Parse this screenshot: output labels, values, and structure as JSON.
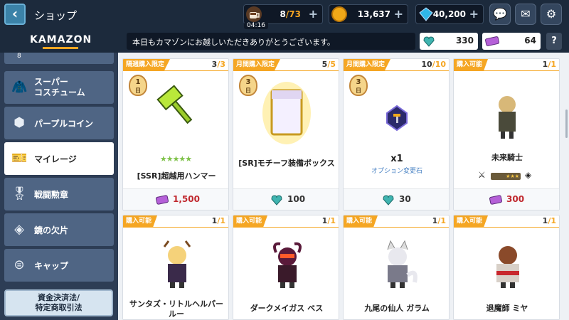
{
  "header": {
    "title": "ショップ",
    "stamina": {
      "value": "8",
      "max": "/73",
      "timer": "04:16"
    },
    "gold": "13,637",
    "gems": "40,200"
  },
  "subheader": {
    "logo": "KAMAZON",
    "notice": "本日もカマゾンにお越しいただきありがとうございます。",
    "currency_hearts": "330",
    "currency_tickets": "64",
    "help": "?"
  },
  "sidebar": {
    "partial_top": "8",
    "items": [
      {
        "label": "スーパー\nコスチューム",
        "icon": "jacket-icon"
      },
      {
        "label": "パープルコイン",
        "icon": "purple-coin-icon"
      },
      {
        "label": "マイレージ",
        "icon": "ticket-icon",
        "active": true
      },
      {
        "label": "戦闘勲章",
        "icon": "medal-icon"
      },
      {
        "label": "鏡の欠片",
        "icon": "mirror-shard-icon"
      },
      {
        "label": "キャップ",
        "icon": "cap-icon"
      }
    ],
    "legal_button": "資金決済法/\n特定商取引法"
  },
  "cards": [
    {
      "tag": "隔週購入限定",
      "count": "3",
      "max": "/3",
      "badge_num": "1",
      "badge_unit": "日",
      "name": "[SSR]超越用ハンマー",
      "price": "1,500",
      "price_icon": "ticket-icon",
      "stars": "★★★★★"
    },
    {
      "tag": "月間購入限定",
      "count": "5",
      "max": "/5",
      "badge_num": "3",
      "badge_unit": "日",
      "name": "[SR]モチーフ装備ボックス",
      "price": "100",
      "price_icon": "heart-icon"
    },
    {
      "tag": "月間購入限定",
      "count": "10",
      "max": "/10",
      "badge_num": "3",
      "badge_unit": "日",
      "name": "x1",
      "sub": "オプション変更石",
      "price": "30",
      "price_icon": "heart-icon"
    },
    {
      "tag": "購入可能",
      "count": "1",
      "max": "/1",
      "name": "未来騎士",
      "price": "300",
      "price_icon": "ticket-icon"
    },
    {
      "tag": "購入可能",
      "count": "1",
      "max": "/1",
      "name": "サンタズ・リトルヘルパー\nルー"
    },
    {
      "tag": "購入可能",
      "count": "1",
      "max": "/1",
      "name": "ダークメイガス ベス"
    },
    {
      "tag": "購入可能",
      "count": "1",
      "max": "/1",
      "name": "九尾の仙人 ガラム"
    },
    {
      "tag": "購入可能",
      "count": "1",
      "max": "/1",
      "name": "退魔師 ミヤ"
    }
  ]
}
